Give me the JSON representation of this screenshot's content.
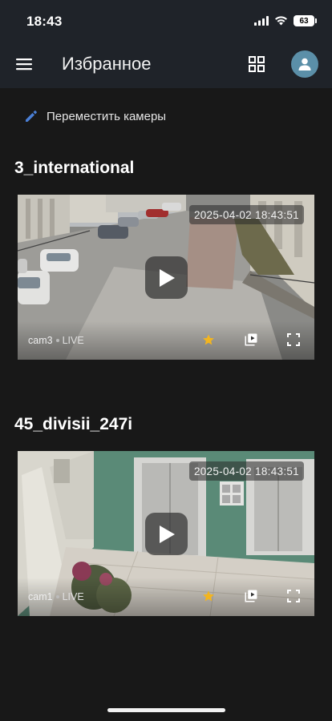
{
  "status_bar": {
    "time": "18:43",
    "battery": "63"
  },
  "app_bar": {
    "title": "Избранное"
  },
  "move_cameras": {
    "label": "Переместить камеры"
  },
  "cameras": [
    {
      "title": "3_international",
      "timestamp": "2025-04-02 18:43:51",
      "cam_id": "cam3",
      "live": "LIVE"
    },
    {
      "title": "45_divisii_247i",
      "timestamp": "2025-04-02 18:43:51",
      "cam_id": "cam1",
      "live": "LIVE"
    }
  ],
  "colors": {
    "accent_blue": "#4a7fd6",
    "favorite_star": "#f3b51f",
    "background": "#181818",
    "app_bar": "#1f2329"
  },
  "icons": [
    "menu-icon",
    "grid-icon",
    "user-icon",
    "pencil-icon",
    "play-icon",
    "star-icon",
    "playlist-play-icon",
    "fullscreen-icon",
    "cellular-signal-icon",
    "wifi-icon",
    "battery-icon"
  ]
}
